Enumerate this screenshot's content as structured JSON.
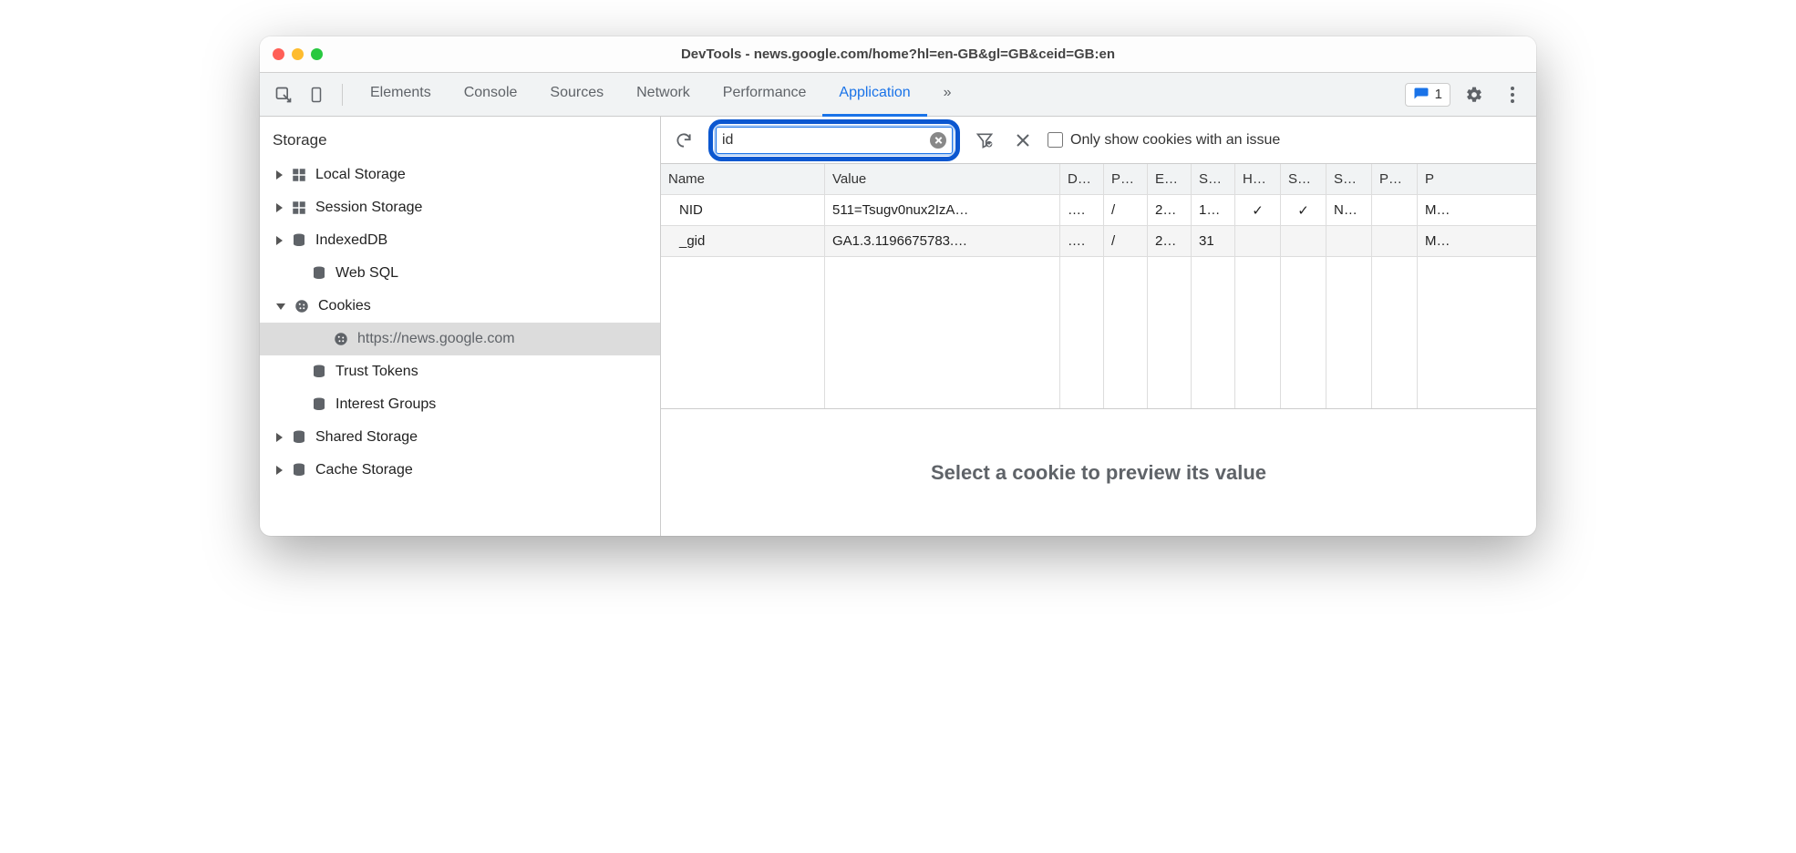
{
  "window": {
    "title": "DevTools - news.google.com/home?hl=en-GB&gl=GB&ceid=GB:en"
  },
  "tabs": {
    "items": [
      "Elements",
      "Console",
      "Sources",
      "Network",
      "Performance",
      "Application"
    ],
    "overflow": "»",
    "active": "Application",
    "issues_count": "1"
  },
  "sidebar": {
    "header": "Storage",
    "items": [
      {
        "label": "Local Storage",
        "icon": "grid",
        "arrow": "right",
        "level": 1
      },
      {
        "label": "Session Storage",
        "icon": "grid",
        "arrow": "right",
        "level": 1
      },
      {
        "label": "IndexedDB",
        "icon": "db",
        "arrow": "right",
        "level": 1
      },
      {
        "label": "Web SQL",
        "icon": "db",
        "arrow": "none",
        "level": 2
      },
      {
        "label": "Cookies",
        "icon": "cookie",
        "arrow": "down",
        "level": 1
      },
      {
        "label": "https://news.google.com",
        "icon": "cookie",
        "arrow": "none",
        "level": 3,
        "selected": true
      },
      {
        "label": "Trust Tokens",
        "icon": "db",
        "arrow": "none",
        "level": 2
      },
      {
        "label": "Interest Groups",
        "icon": "db",
        "arrow": "none",
        "level": 2
      },
      {
        "label": "Shared Storage",
        "icon": "db",
        "arrow": "right",
        "level": 1
      },
      {
        "label": "Cache Storage",
        "icon": "db",
        "arrow": "right",
        "level": 1
      }
    ]
  },
  "toolbar": {
    "filter_value": "id",
    "checkbox_label": "Only show cookies with an issue"
  },
  "table": {
    "columns": [
      "Name",
      "Value",
      "D…",
      "P…",
      "E…",
      "S…",
      "H…",
      "S…",
      "S…",
      "P…",
      "P"
    ],
    "rows": [
      {
        "name": "NID",
        "value": "511=Tsugv0nux2IzA…",
        "d": "….",
        "p": "/",
        "e": "2…",
        "s": "1…",
        "h": "✓",
        "s2": "✓",
        "s3": "N…",
        "p2": "",
        "p3": "M…"
      },
      {
        "name": "_gid",
        "value": "GA1.3.1196675783.…",
        "d": "….",
        "p": "/",
        "e": "2…",
        "s": "31",
        "h": "",
        "s2": "",
        "s3": "",
        "p2": "",
        "p3": "M…"
      }
    ]
  },
  "preview": {
    "placeholder": "Select a cookie to preview its value"
  }
}
